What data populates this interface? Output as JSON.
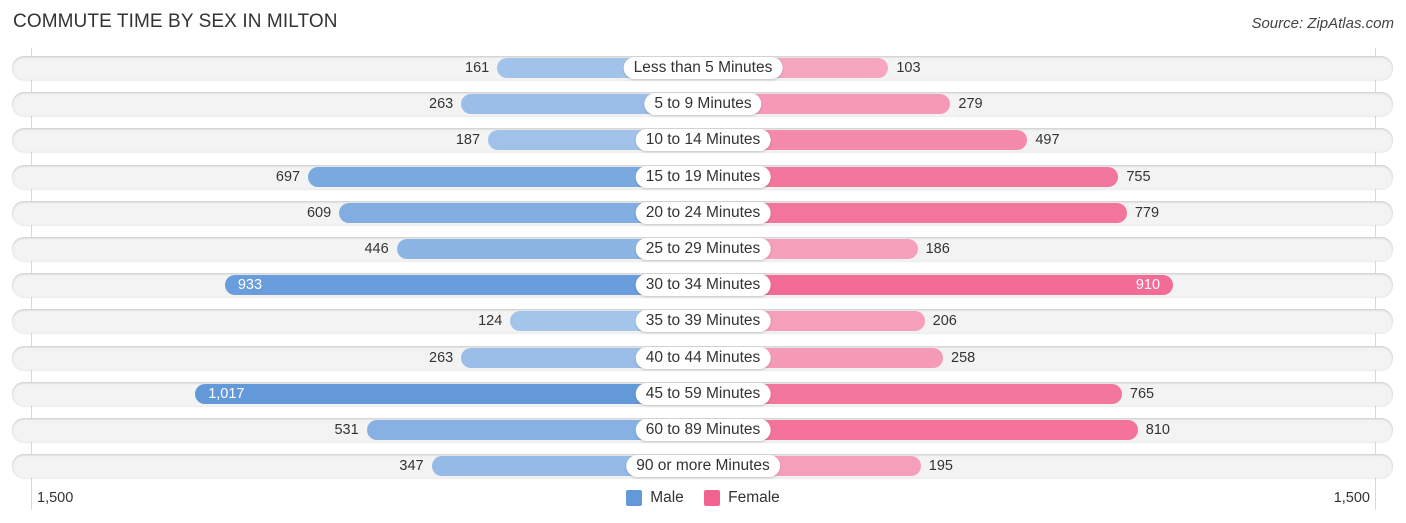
{
  "title": "COMMUTE TIME BY SEX IN MILTON",
  "source": "Source: ZipAtlas.com",
  "colors": {
    "male_dark": "#6399d9",
    "male_light": "#a6c6ea",
    "female_dark": "#f2648f",
    "female_light": "#f7a6bf",
    "row_bg": "#f3f3f3"
  },
  "chart_data": {
    "type": "bar",
    "orientation": "horizontal-diverging",
    "title": "COMMUTE TIME BY SEX IN MILTON",
    "categories": [
      "Less than 5 Minutes",
      "5 to 9 Minutes",
      "10 to 14 Minutes",
      "15 to 19 Minutes",
      "20 to 24 Minutes",
      "25 to 29 Minutes",
      "30 to 34 Minutes",
      "35 to 39 Minutes",
      "40 to 44 Minutes",
      "45 to 59 Minutes",
      "60 to 89 Minutes",
      "90 or more Minutes"
    ],
    "series": [
      {
        "name": "Male",
        "values": [
          161,
          263,
          187,
          697,
          609,
          446,
          933,
          124,
          263,
          1017,
          531,
          347
        ],
        "labels": [
          "161",
          "263",
          "187",
          "697",
          "609",
          "446",
          "933",
          "124",
          "263",
          "1,017",
          "531",
          "347"
        ]
      },
      {
        "name": "Female",
        "values": [
          103,
          279,
          497,
          755,
          779,
          186,
          910,
          206,
          258,
          765,
          810,
          195
        ],
        "labels": [
          "103",
          "279",
          "497",
          "755",
          "779",
          "186",
          "910",
          "206",
          "258",
          "765",
          "810",
          "195"
        ]
      }
    ],
    "xlim": [
      -1500,
      1500
    ],
    "axis_ticks": {
      "left": "1,500",
      "right": "1,500"
    },
    "legend": {
      "position": "bottom-center",
      "entries": [
        "Male",
        "Female"
      ]
    },
    "grid": false
  }
}
